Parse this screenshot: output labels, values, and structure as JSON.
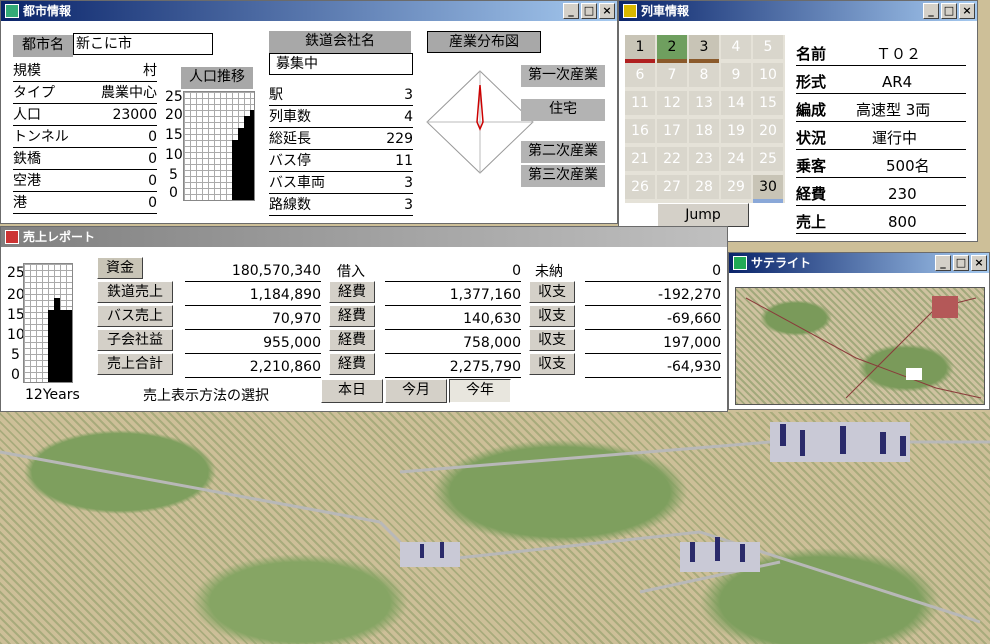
{
  "city_window": {
    "title": "都市情報",
    "city_label": "都市名",
    "city_name": "新こに市",
    "stats": [
      {
        "label": "規模",
        "value": "村"
      },
      {
        "label": "タイプ",
        "value": "農業中心"
      },
      {
        "label": "人口",
        "value": "23000"
      },
      {
        "label": "トンネル",
        "value": "0"
      },
      {
        "label": "鉄橋",
        "value": "0"
      },
      {
        "label": "空港",
        "value": "0"
      },
      {
        "label": "港",
        "value": "0"
      }
    ],
    "pop_trend_label": "人口推移",
    "pop_axis": [
      "25",
      "20",
      "15",
      "10",
      "5",
      "0"
    ],
    "railway_company_label": "鉄道会社名",
    "railway_company_value": "募集中",
    "rail_stats": [
      {
        "label": "駅",
        "value": "3"
      },
      {
        "label": "列車数",
        "value": "4"
      },
      {
        "label": "総延長",
        "value": "229"
      },
      {
        "label": "バス停",
        "value": "11"
      },
      {
        "label": "バス車両",
        "value": "3"
      },
      {
        "label": "路線数",
        "value": "3"
      }
    ],
    "industry_map_label": "産業分布図",
    "industry_tags": [
      "第一次産業",
      "住宅",
      "第二次産業",
      "第三次産業"
    ]
  },
  "train_window": {
    "title": "列車情報",
    "numbers": [
      "1",
      "2",
      "3",
      "4",
      "5",
      "6",
      "7",
      "8",
      "9",
      "10",
      "11",
      "12",
      "13",
      "14",
      "15",
      "16",
      "17",
      "18",
      "19",
      "20",
      "21",
      "22",
      "23",
      "24",
      "25",
      "26",
      "27",
      "28",
      "29",
      "30"
    ],
    "jump_label": "Jump",
    "details": [
      {
        "label": "名前",
        "value": "Ｔ０２"
      },
      {
        "label": "形式",
        "value": "AR4"
      },
      {
        "label": "編成",
        "value": "高速型 3両"
      },
      {
        "label": "状況",
        "value": "運行中"
      },
      {
        "label": "乗客",
        "value": "500名"
      },
      {
        "label": "経費",
        "value": "230"
      },
      {
        "label": "売上",
        "value": "800"
      }
    ]
  },
  "sales_window": {
    "title": "売上レポート",
    "axis": [
      "25",
      "20",
      "15",
      "10",
      "5",
      "0"
    ],
    "years_label": "12Years",
    "left_labels": [
      "資金",
      "鉄道売上",
      "バス売上",
      "子会社益",
      "売上合計"
    ],
    "left_values": [
      "180,570,340",
      "1,184,890",
      "70,970",
      "955,000",
      "2,210,860"
    ],
    "mid_labels": [
      "借入",
      "経費",
      "経費",
      "経費",
      "経費"
    ],
    "mid_values": [
      "0",
      "1,377,160",
      "140,630",
      "758,000",
      "2,275,790"
    ],
    "right_labels": [
      "未納",
      "収支",
      "収支",
      "収支",
      "収支"
    ],
    "right_values": [
      "0",
      "-192,270",
      "-69,660",
      "197,000",
      "-64,930"
    ],
    "mode_label": "売上表示方法の選択",
    "mode_buttons": [
      "本日",
      "今月",
      "今年"
    ]
  },
  "satellite_window": {
    "title": "サテライト"
  }
}
